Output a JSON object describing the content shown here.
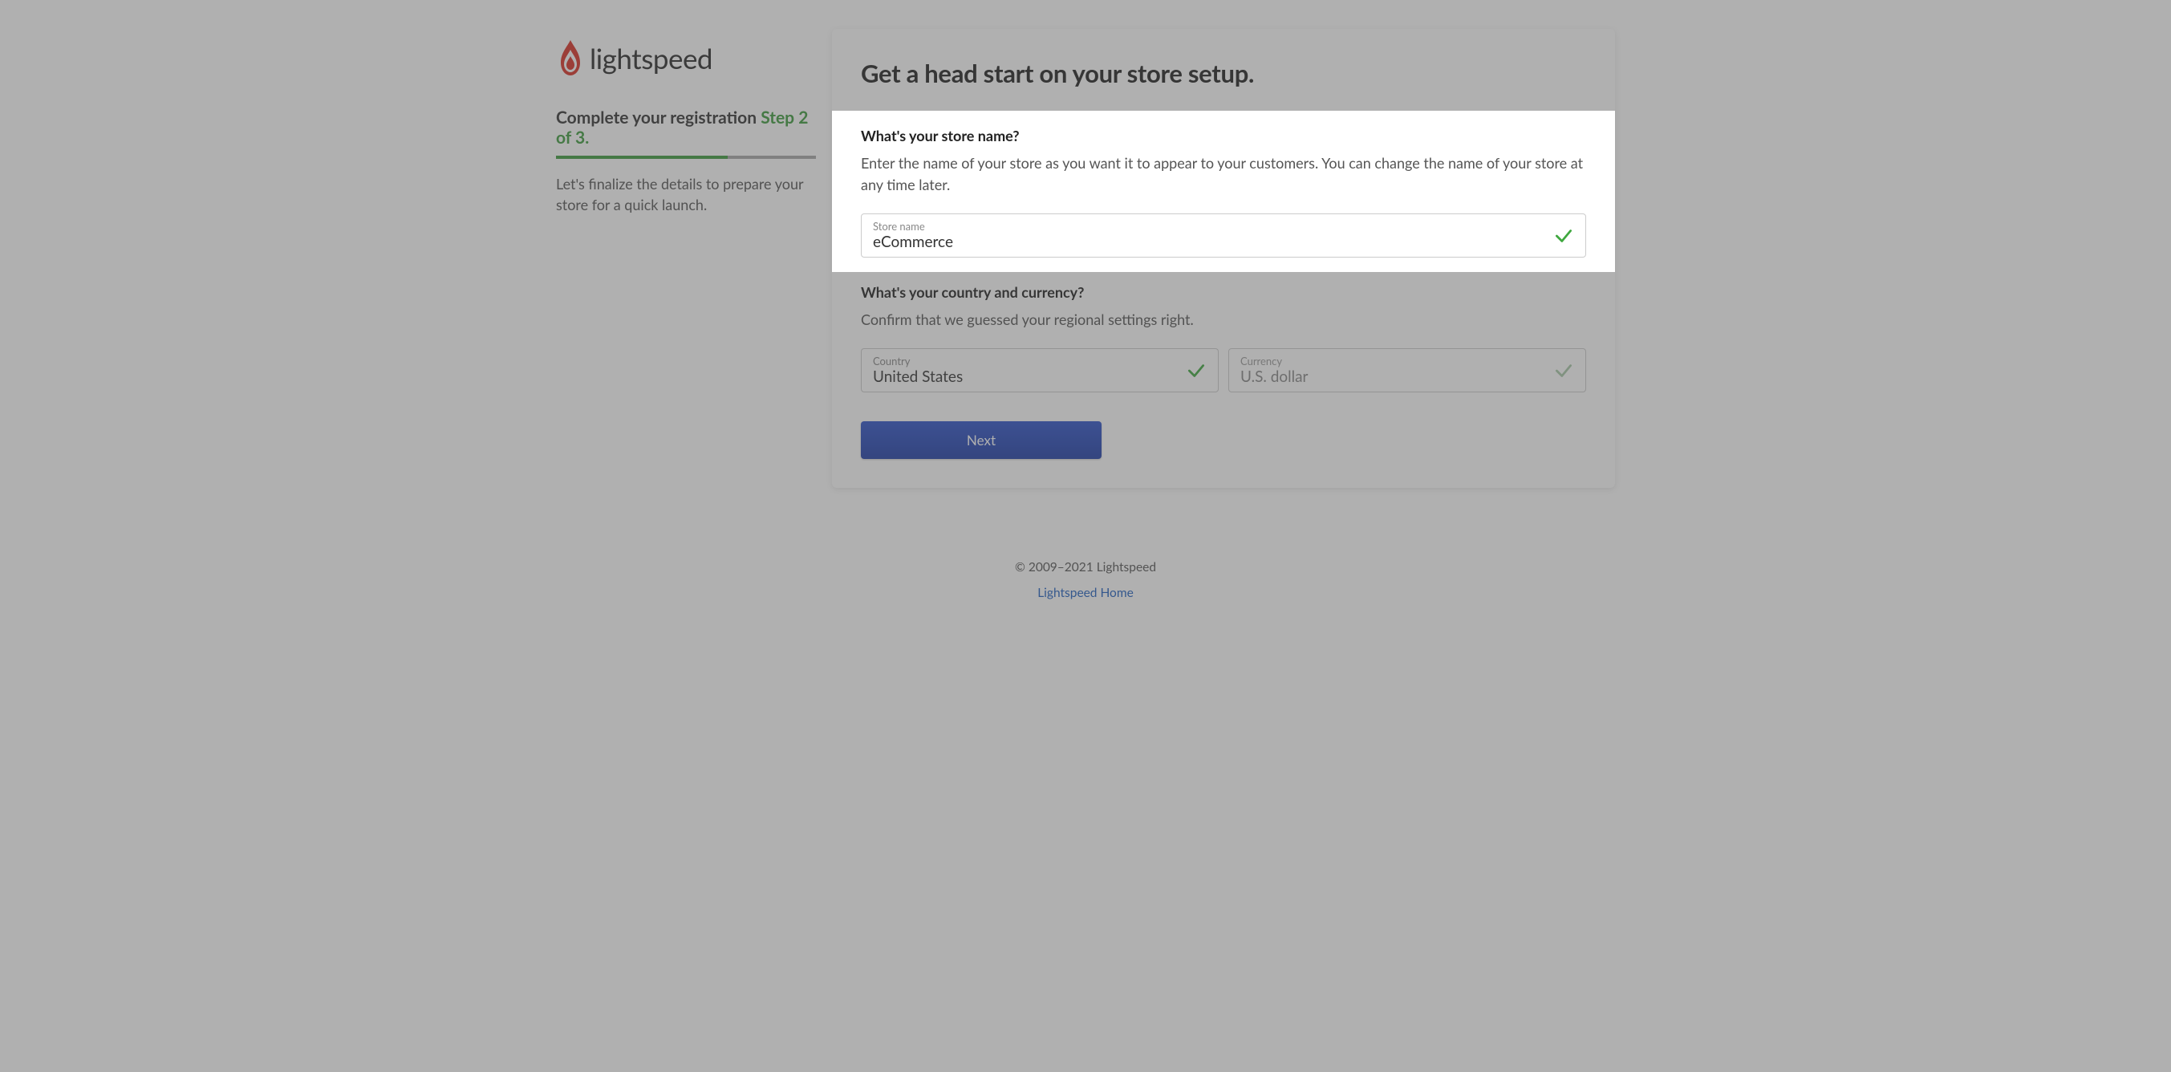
{
  "brand": {
    "name": "lightspeed"
  },
  "sidebar": {
    "heading_prefix": "Complete your registration",
    "step_label": "Step 2 of 3.",
    "progress_percent": 66,
    "description": "Let's finalize the details to prepare your store for a quick launch."
  },
  "card": {
    "title": "Get a head start on your store setup.",
    "store_name_section": {
      "heading": "What's your store name?",
      "description": "Enter the name of your store as you want it to appear to your customers. You can change the name of your store at any time later.",
      "field_label": "Store name",
      "field_value": "eCommerce"
    },
    "region_section": {
      "heading": "What's your country and currency?",
      "description": "Confirm that we guessed your regional settings right.",
      "country_label": "Country",
      "country_value": "United States",
      "currency_label": "Currency",
      "currency_value": "U.S. dollar"
    },
    "next_button": "Next"
  },
  "footer": {
    "copyright": "© 2009–2021 Lightspeed",
    "home_link": "Lightspeed Home"
  }
}
